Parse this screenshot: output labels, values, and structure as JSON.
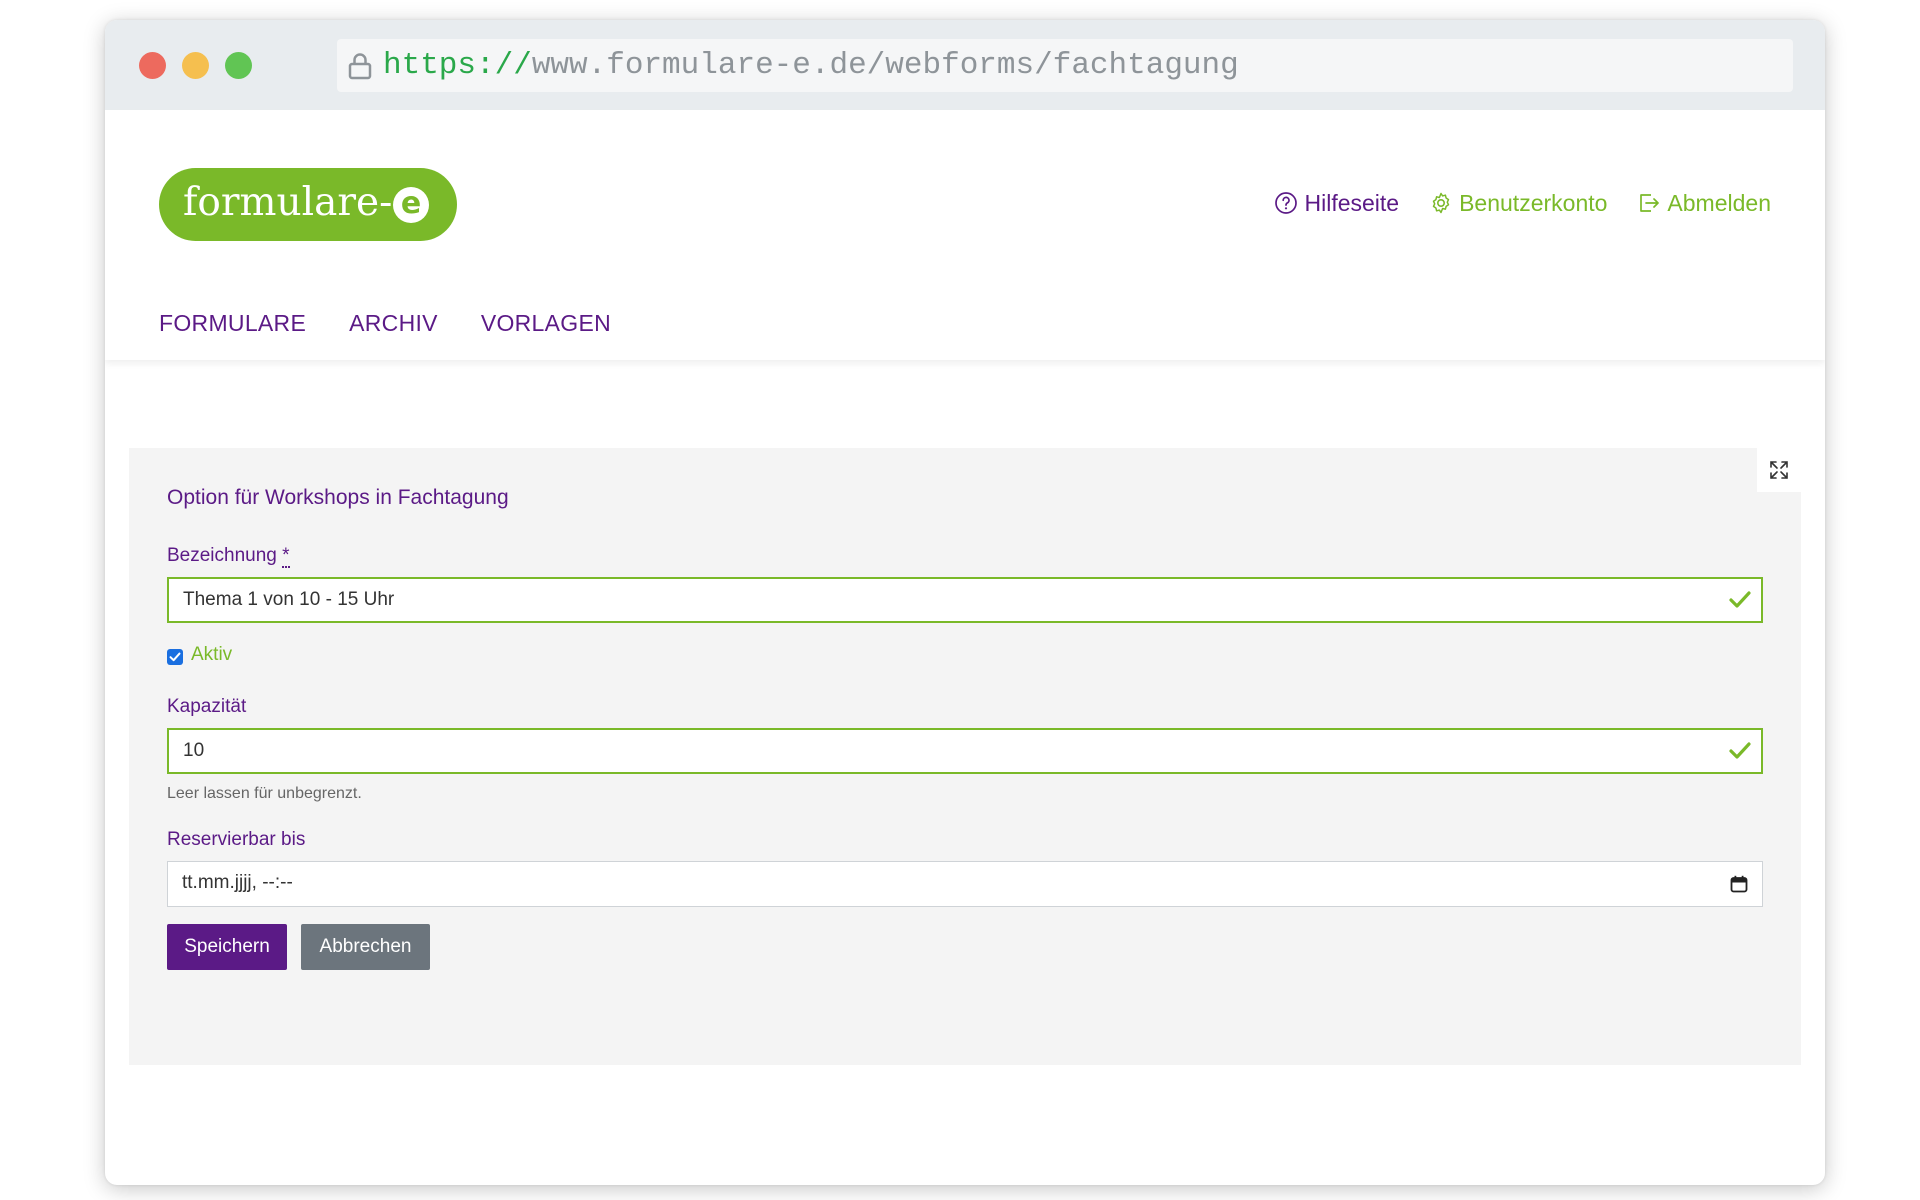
{
  "browser": {
    "url_scheme": "https://",
    "url_rest": "www.formulare-e.de/webforms/fachtagung"
  },
  "logo": {
    "text": "formulare-",
    "badge": "e"
  },
  "toplinks": [
    {
      "label": "Hilfeseite",
      "icon": "question-circle-icon"
    },
    {
      "label": "Benutzerkonto",
      "icon": "gear-icon"
    },
    {
      "label": "Abmelden",
      "icon": "logout-icon"
    }
  ],
  "nav": [
    {
      "label": "FORMULARE"
    },
    {
      "label": "ARCHIV"
    },
    {
      "label": "VORLAGEN"
    }
  ],
  "form": {
    "title": "Option für Workshops in Fachtagung",
    "bezeichnung_label": "Bezeichnung",
    "required_marker": "*",
    "bezeichnung_value": "Thema 1 von 10 - 15 Uhr",
    "aktiv_label": "Aktiv",
    "aktiv_checked": true,
    "kapazitaet_label": "Kapazität",
    "kapazitaet_value": "10",
    "kapazitaet_help": "Leer lassen für unbegrenzt.",
    "reservierbar_label": "Reservierbar bis",
    "reservierbar_placeholder": "tt.mm.jjjj, --:--",
    "save_label": "Speichern",
    "cancel_label": "Abbrechen"
  },
  "colors": {
    "brand_green": "#7ab929",
    "brand_purple": "#5b1a86",
    "secondary_gray": "#6c757d",
    "checkbox_blue": "#1a6fe0"
  }
}
